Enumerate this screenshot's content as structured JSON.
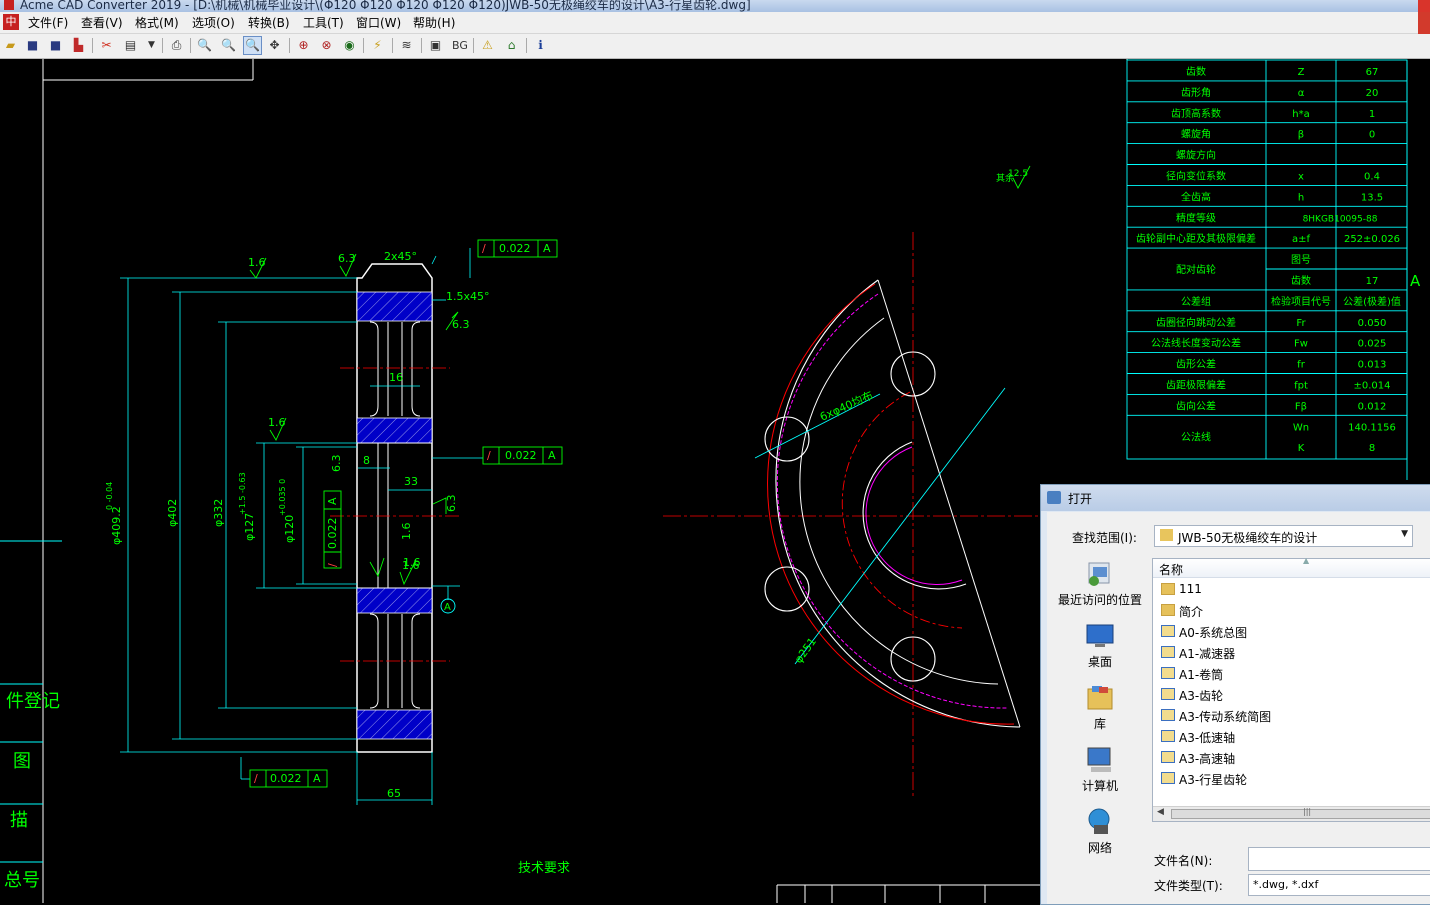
{
  "window": {
    "title": "Acme CAD Converter 2019 - [D:\\机械\\机械毕业设计\\(Φ120 Φ120 Φ120 Φ120 Φ120)JWB-50无极绳绞车的设计\\A3-行星齿轮.dwg]"
  },
  "menu": {
    "items": [
      "文件(F)",
      "查看(V)",
      "格式(M)",
      "选项(O)",
      "转换(B)",
      "工具(T)",
      "窗口(W)",
      "帮助(H)"
    ]
  },
  "toolbar": {
    "bg_label": "BG"
  },
  "drawing": {
    "dims": {
      "d1": "1.6",
      "d2": "6.3",
      "chamfer1": "2x45°",
      "chamfer2": "1.5x45°",
      "d3": "6.3",
      "d4": "16",
      "d5": "1.6",
      "d6": "6.3",
      "d7": "8",
      "d8": "33",
      "d9": "6.3",
      "d10": "1.6",
      "d11": "1.6",
      "d12": "1.6",
      "d13": "65",
      "od": "φ409.2",
      "od_tol": "0\n-0.04",
      "d402": "φ402",
      "d332": "φ332",
      "d127": "φ127",
      "d127_tol": "+1.5\n-0.63",
      "d120": "φ120",
      "d120_tol": "+0.035\n0",
      "hole_label": "6xφ40均布",
      "pcd": "φ251",
      "rough_all": "其余",
      "rough_all_val": "12.5",
      "tech_req": "技术要求"
    },
    "tol_frames": [
      {
        "sym": "∕",
        "val": "0.022",
        "datum": "A"
      },
      {
        "sym": "∕",
        "val": "0.022",
        "datum": "A"
      },
      {
        "sym": "∕",
        "val": "0.022",
        "datum": "A"
      },
      {
        "sym": "∕",
        "val": "0.022",
        "datum": "A"
      }
    ],
    "datum_a": "A",
    "side_labels": [
      "件登记",
      "图",
      "描",
      "总号"
    ],
    "params": [
      {
        "name": "齿数",
        "sym": "Z",
        "val": "67"
      },
      {
        "name": "齿形角",
        "sym": "α",
        "val": "20"
      },
      {
        "name": "齿顶高系数",
        "sym": "h*a",
        "val": "1"
      },
      {
        "name": "螺旋角",
        "sym": "β",
        "val": "0"
      },
      {
        "name": "螺旋方向",
        "sym": "",
        "val": ""
      },
      {
        "name": "径向变位系数",
        "sym": "x",
        "val": "0.4"
      },
      {
        "name": "全齿高",
        "sym": "h",
        "val": "13.5"
      },
      {
        "name": "精度等级",
        "sym": "8HKGB10095-88",
        "val": ""
      },
      {
        "name": "齿轮副中心距及其极限偏差",
        "sym": "a±f",
        "val": "252±0.026"
      },
      {
        "name": "配对齿轮",
        "sym": "图号",
        "val": ""
      },
      {
        "name": "",
        "sym": "齿数",
        "val": "17"
      },
      {
        "name": "公差组",
        "sym": "检验项目代号",
        "val": "公差(极差)值"
      },
      {
        "name": "齿圈径向跳动公差",
        "sym": "Fr",
        "val": "0.050"
      },
      {
        "name": "公法线长度变动公差",
        "sym": "Fw",
        "val": "0.025"
      },
      {
        "name": "齿形公差",
        "sym": "fr",
        "val": "0.013"
      },
      {
        "name": "齿距极限偏差",
        "sym": "fpt",
        "val": "±0.014"
      },
      {
        "name": "齿向公差",
        "sym": "Fβ",
        "val": "0.012"
      },
      {
        "name": "公法线",
        "sym": "Wn",
        "val": "140.1156"
      },
      {
        "name": "",
        "sym": "K",
        "val": "8"
      }
    ],
    "table_side_a": "A"
  },
  "dialog": {
    "title": "打开",
    "look_in_label": "查找范围(I):",
    "look_in_value": "JWB-50无极绳绞车的设计",
    "places": [
      "最近访问的位置",
      "桌面",
      "库",
      "计算机",
      "网络"
    ],
    "column_name": "名称",
    "files": [
      {
        "name": "111",
        "kind": "folder"
      },
      {
        "name": "简介",
        "kind": "folder"
      },
      {
        "name": "A0-系统总图",
        "kind": "dwg"
      },
      {
        "name": "A1-减速器",
        "kind": "dwg"
      },
      {
        "name": "A1-卷筒",
        "kind": "dwg"
      },
      {
        "name": "A3-齿轮",
        "kind": "dwg"
      },
      {
        "name": "A3-传动系统简图",
        "kind": "dwg"
      },
      {
        "name": "A3-低速轴",
        "kind": "dwg"
      },
      {
        "name": "A3-高速轴",
        "kind": "dwg"
      },
      {
        "name": "A3-行星齿轮",
        "kind": "dwg"
      }
    ],
    "filename_label": "文件名(N):",
    "filename_value": "",
    "filetype_label": "文件类型(T):",
    "filetype_value": "*.dwg, *.dxf"
  },
  "colors": {
    "cad_green": "#00ff00",
    "cad_cyan": "#00ffff",
    "cad_red": "#ff0000",
    "cad_white": "#ffffff",
    "cad_magenta": "#ff00ff",
    "hatch_blue": "#0000c8"
  }
}
